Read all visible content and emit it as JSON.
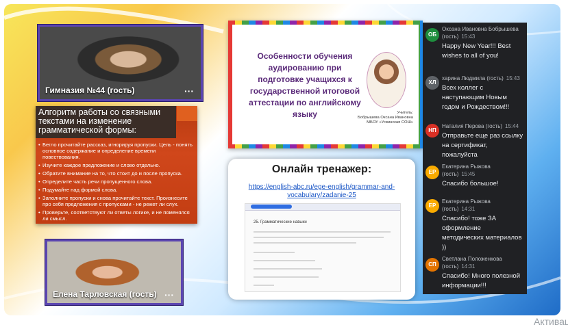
{
  "colors": {
    "accent": "#5b45b0",
    "chat_bg": "#202124"
  },
  "participants": [
    {
      "name": "Гимназия №44 (гость)",
      "more": "···"
    },
    {
      "name": "Елена Тарловская (гость)",
      "more": "···"
    }
  ],
  "algorithm_slide": {
    "title": "Алгоритм работы со связными текстами на изменение грамматической формы:",
    "items": [
      "Бегло прочитайте рассказ, игнорируя пропуски. Цель - понять основное содержание и определение времени повествования.",
      "Изучите каждое предложение и слово отдельно.",
      "Обратите внимание на то, что стоит до и после пропуска.",
      "Определите часть речи пропущенного слова.",
      "Подумайте над формой слова.",
      "Заполните пропуски и снова прочитайте текст. Произнесите про себя предложения с пропусками - не режет ли слух.",
      "Проверьте, соответствуют ли ответы логике, и не поменялся ли смысл."
    ]
  },
  "title_slide": {
    "title": "Особенности обучения аудированию при подготовке учащихся к государственной итоговой аттестации по английскому языку",
    "author_label": "Учитель:",
    "author_name": "Бобрышева Оксана Ивановна",
    "school": "МБОУ «Усвинская СОШ»"
  },
  "trainer_slide": {
    "title": "Онлайн тренажер:",
    "link": "https://english-abc.ru/ege-english/grammar-and-vocabulary/zadanie-25",
    "task": "25. Грамматические навыки"
  },
  "chat": [
    {
      "initials": "ОБ",
      "color": "#1e8e3e",
      "sender": "Оксана Ивановна Бобрышева (гость)",
      "time": "15:43",
      "text": "Happy New Year!!! Best wishes to all of you!"
    },
    {
      "initials": "ХЛ",
      "color": "#5f6368",
      "sender": "харина Людмила (гость)",
      "time": "15:43",
      "text": "Всех коллег с наступающим Новым годом и Рождеством!!!"
    },
    {
      "initials": "НП",
      "color": "#d93025",
      "sender": "Наталия Перова (гость)",
      "time": "15:44",
      "text": "Отправьте еще раз ссылку на сертификат, пожалуйста"
    },
    {
      "initials": "ЕР",
      "color": "#f9ab00",
      "sender": "Екатерина Рыжова (гость)",
      "time": "15:45",
      "text": "Спасибо большое!"
    },
    {
      "initials": "ЕР",
      "color": "#f9ab00",
      "sender": "Екатерина Рыжова (гость)",
      "time": "14:31",
      "text": "Спасибо! тоже ЗА оформление методических материалов ))"
    },
    {
      "initials": "СП",
      "color": "#e37400",
      "sender": "Светлана Положенкова (гость)",
      "time": "14:31",
      "text": "Спасибо! Много полезной информации!!!"
    }
  ],
  "watermark": "Активац"
}
